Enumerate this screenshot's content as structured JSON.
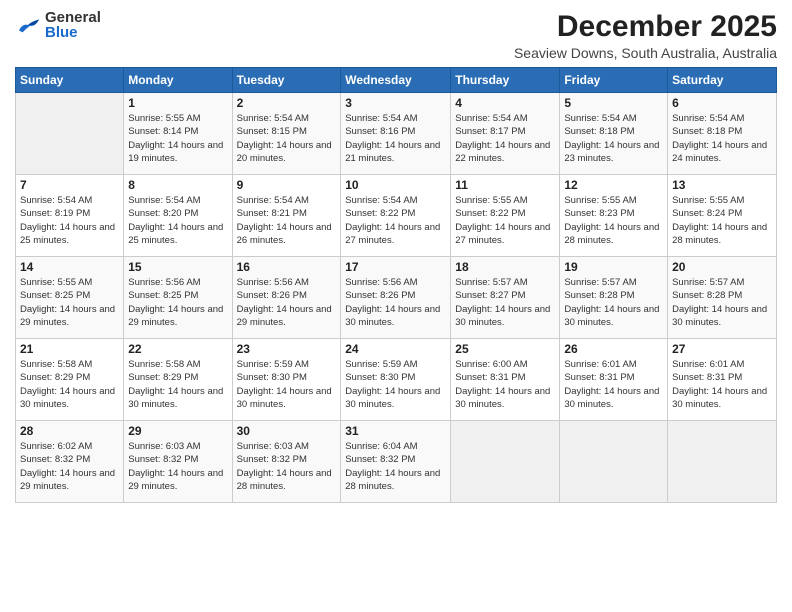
{
  "header": {
    "logo_general": "General",
    "logo_blue": "Blue",
    "month": "December 2025",
    "location": "Seaview Downs, South Australia, Australia"
  },
  "weekdays": [
    "Sunday",
    "Monday",
    "Tuesday",
    "Wednesday",
    "Thursday",
    "Friday",
    "Saturday"
  ],
  "weeks": [
    [
      {
        "day": "",
        "info": ""
      },
      {
        "day": "1",
        "info": "Sunrise: 5:55 AM\nSunset: 8:14 PM\nDaylight: 14 hours\nand 19 minutes."
      },
      {
        "day": "2",
        "info": "Sunrise: 5:54 AM\nSunset: 8:15 PM\nDaylight: 14 hours\nand 20 minutes."
      },
      {
        "day": "3",
        "info": "Sunrise: 5:54 AM\nSunset: 8:16 PM\nDaylight: 14 hours\nand 21 minutes."
      },
      {
        "day": "4",
        "info": "Sunrise: 5:54 AM\nSunset: 8:17 PM\nDaylight: 14 hours\nand 22 minutes."
      },
      {
        "day": "5",
        "info": "Sunrise: 5:54 AM\nSunset: 8:18 PM\nDaylight: 14 hours\nand 23 minutes."
      },
      {
        "day": "6",
        "info": "Sunrise: 5:54 AM\nSunset: 8:18 PM\nDaylight: 14 hours\nand 24 minutes."
      }
    ],
    [
      {
        "day": "7",
        "info": "Sunrise: 5:54 AM\nSunset: 8:19 PM\nDaylight: 14 hours\nand 25 minutes."
      },
      {
        "day": "8",
        "info": "Sunrise: 5:54 AM\nSunset: 8:20 PM\nDaylight: 14 hours\nand 25 minutes."
      },
      {
        "day": "9",
        "info": "Sunrise: 5:54 AM\nSunset: 8:21 PM\nDaylight: 14 hours\nand 26 minutes."
      },
      {
        "day": "10",
        "info": "Sunrise: 5:54 AM\nSunset: 8:22 PM\nDaylight: 14 hours\nand 27 minutes."
      },
      {
        "day": "11",
        "info": "Sunrise: 5:55 AM\nSunset: 8:22 PM\nDaylight: 14 hours\nand 27 minutes."
      },
      {
        "day": "12",
        "info": "Sunrise: 5:55 AM\nSunset: 8:23 PM\nDaylight: 14 hours\nand 28 minutes."
      },
      {
        "day": "13",
        "info": "Sunrise: 5:55 AM\nSunset: 8:24 PM\nDaylight: 14 hours\nand 28 minutes."
      }
    ],
    [
      {
        "day": "14",
        "info": "Sunrise: 5:55 AM\nSunset: 8:25 PM\nDaylight: 14 hours\nand 29 minutes."
      },
      {
        "day": "15",
        "info": "Sunrise: 5:56 AM\nSunset: 8:25 PM\nDaylight: 14 hours\nand 29 minutes."
      },
      {
        "day": "16",
        "info": "Sunrise: 5:56 AM\nSunset: 8:26 PM\nDaylight: 14 hours\nand 29 minutes."
      },
      {
        "day": "17",
        "info": "Sunrise: 5:56 AM\nSunset: 8:26 PM\nDaylight: 14 hours\nand 30 minutes."
      },
      {
        "day": "18",
        "info": "Sunrise: 5:57 AM\nSunset: 8:27 PM\nDaylight: 14 hours\nand 30 minutes."
      },
      {
        "day": "19",
        "info": "Sunrise: 5:57 AM\nSunset: 8:28 PM\nDaylight: 14 hours\nand 30 minutes."
      },
      {
        "day": "20",
        "info": "Sunrise: 5:57 AM\nSunset: 8:28 PM\nDaylight: 14 hours\nand 30 minutes."
      }
    ],
    [
      {
        "day": "21",
        "info": "Sunrise: 5:58 AM\nSunset: 8:29 PM\nDaylight: 14 hours\nand 30 minutes."
      },
      {
        "day": "22",
        "info": "Sunrise: 5:58 AM\nSunset: 8:29 PM\nDaylight: 14 hours\nand 30 minutes."
      },
      {
        "day": "23",
        "info": "Sunrise: 5:59 AM\nSunset: 8:30 PM\nDaylight: 14 hours\nand 30 minutes."
      },
      {
        "day": "24",
        "info": "Sunrise: 5:59 AM\nSunset: 8:30 PM\nDaylight: 14 hours\nand 30 minutes."
      },
      {
        "day": "25",
        "info": "Sunrise: 6:00 AM\nSunset: 8:31 PM\nDaylight: 14 hours\nand 30 minutes."
      },
      {
        "day": "26",
        "info": "Sunrise: 6:01 AM\nSunset: 8:31 PM\nDaylight: 14 hours\nand 30 minutes."
      },
      {
        "day": "27",
        "info": "Sunrise: 6:01 AM\nSunset: 8:31 PM\nDaylight: 14 hours\nand 30 minutes."
      }
    ],
    [
      {
        "day": "28",
        "info": "Sunrise: 6:02 AM\nSunset: 8:32 PM\nDaylight: 14 hours\nand 29 minutes."
      },
      {
        "day": "29",
        "info": "Sunrise: 6:03 AM\nSunset: 8:32 PM\nDaylight: 14 hours\nand 29 minutes."
      },
      {
        "day": "30",
        "info": "Sunrise: 6:03 AM\nSunset: 8:32 PM\nDaylight: 14 hours\nand 28 minutes."
      },
      {
        "day": "31",
        "info": "Sunrise: 6:04 AM\nSunset: 8:32 PM\nDaylight: 14 hours\nand 28 minutes."
      },
      {
        "day": "",
        "info": ""
      },
      {
        "day": "",
        "info": ""
      },
      {
        "day": "",
        "info": ""
      }
    ]
  ]
}
